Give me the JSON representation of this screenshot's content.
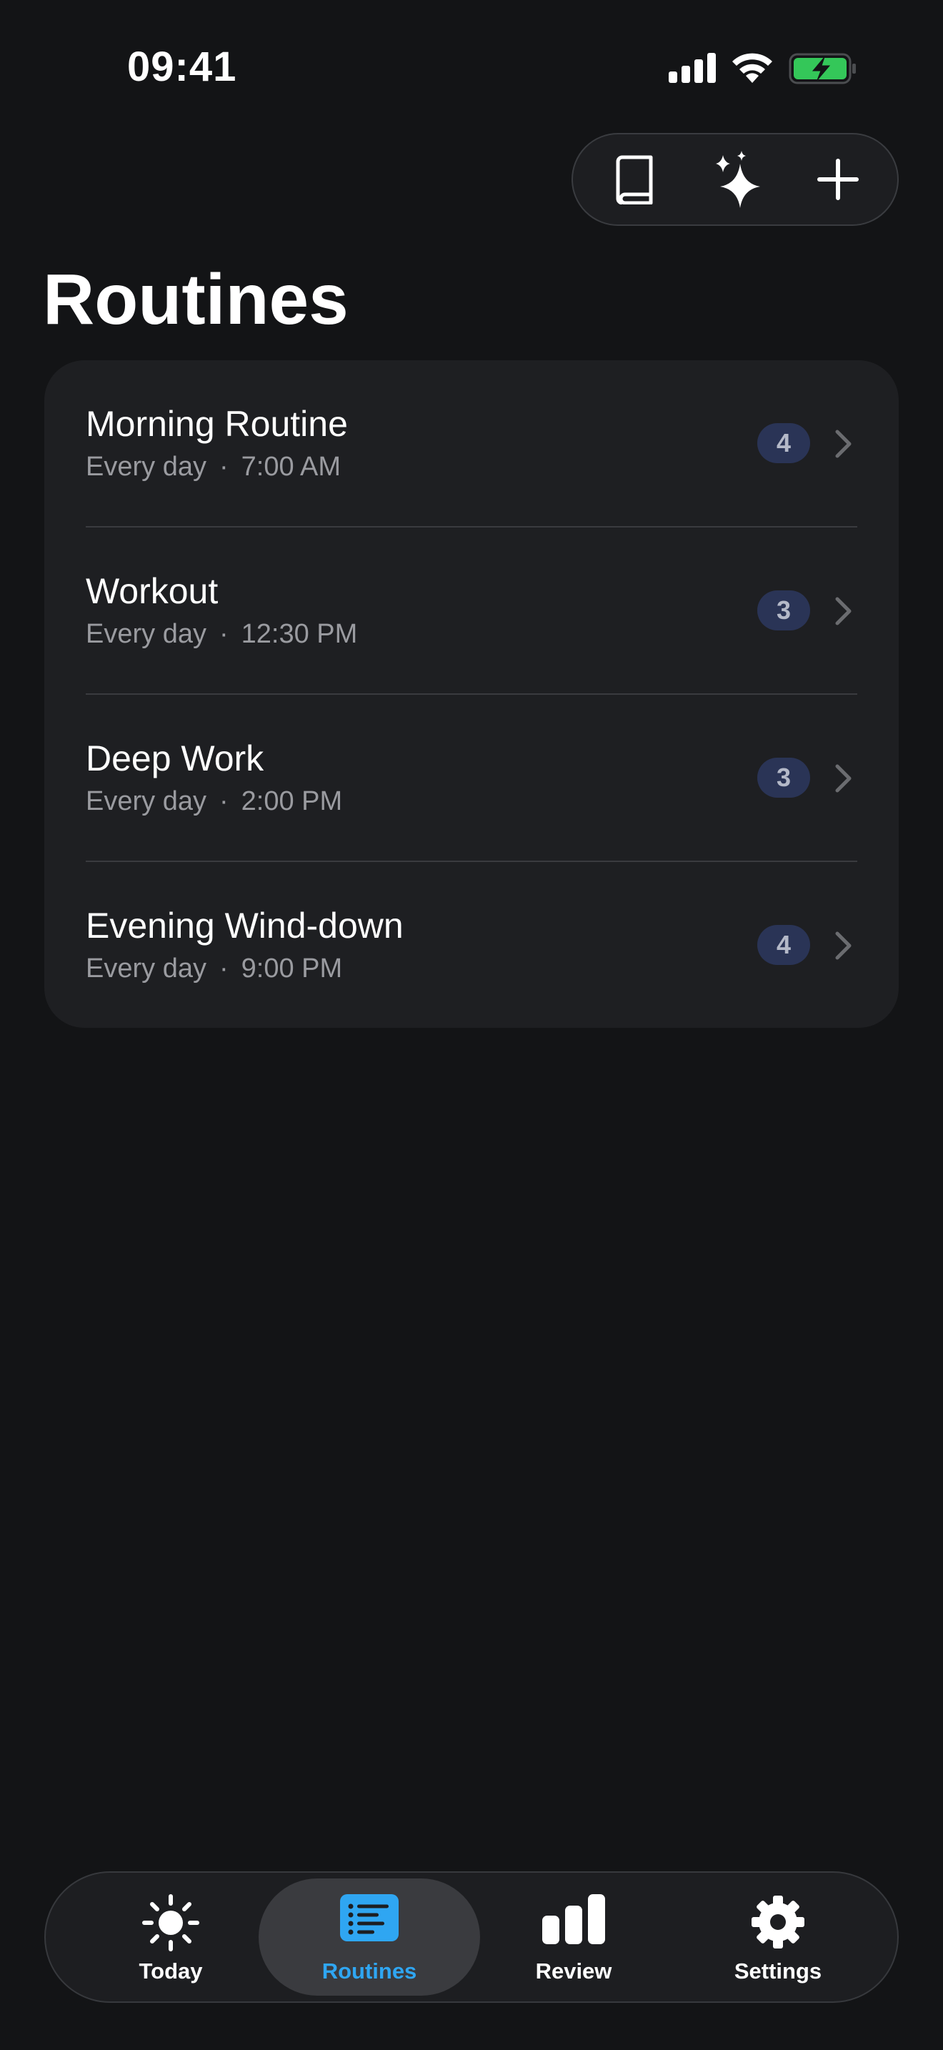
{
  "status_bar": {
    "time": "09:41"
  },
  "toolbar": {
    "icons": [
      "book-icon",
      "sparkles-icon",
      "plus-icon"
    ]
  },
  "page": {
    "title": "Routines"
  },
  "routines": [
    {
      "name": "Morning Routine",
      "frequency": "Every day",
      "separator": "·",
      "time": "7:00 AM",
      "count": "4"
    },
    {
      "name": "Workout",
      "frequency": "Every day",
      "separator": "·",
      "time": "12:30 PM",
      "count": "3"
    },
    {
      "name": "Deep Work",
      "frequency": "Every day",
      "separator": "·",
      "time": "2:00 PM",
      "count": "3"
    },
    {
      "name": "Evening Wind-down",
      "frequency": "Every day",
      "separator": "·",
      "time": "9:00 PM",
      "count": "4"
    }
  ],
  "tab_bar": {
    "tabs": [
      {
        "label": "Today",
        "icon": "sun-icon",
        "active": false
      },
      {
        "label": "Routines",
        "icon": "list-icon",
        "active": true
      },
      {
        "label": "Review",
        "icon": "bar-chart-icon",
        "active": false
      },
      {
        "label": "Settings",
        "icon": "gear-icon",
        "active": false
      }
    ]
  },
  "colors": {
    "background": "#131416",
    "card": "#1e1f22",
    "accent": "#2fa6f2",
    "battery_green": "#34c759",
    "badge": "#2a3456"
  }
}
